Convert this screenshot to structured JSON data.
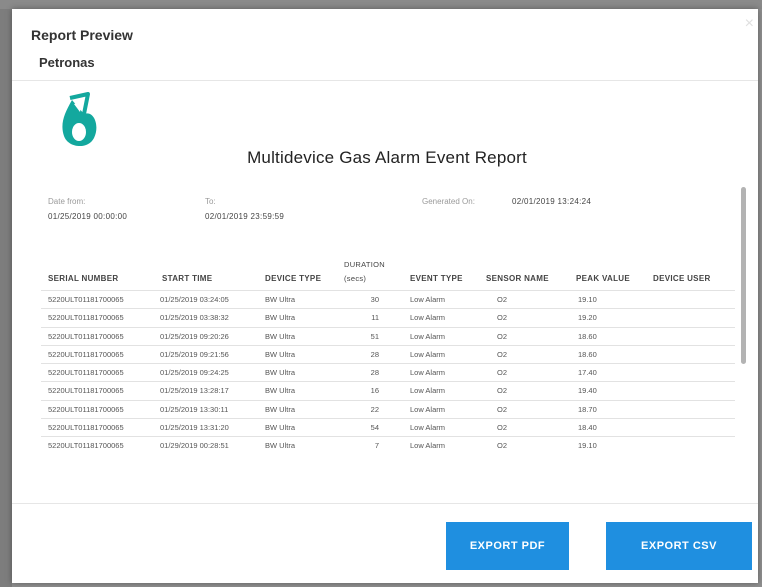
{
  "modal": {
    "title": "Report Preview",
    "subtitle": "Petronas",
    "close_label": "×"
  },
  "report": {
    "title": "Multidevice Gas Alarm Event Report",
    "date_from_label": "Date from:",
    "date_from_value": "01/25/2019 00:00:00",
    "to_label": "To:",
    "to_value": "02/01/2019 23:59:59",
    "generated_label": "Generated On:",
    "generated_value": "02/01/2019 13:24:24"
  },
  "table": {
    "headers": {
      "serial": "SERIAL NUMBER",
      "start": "START TIME",
      "device_type": "DEVICE TYPE",
      "duration": "DURATION",
      "duration_unit": "(secs)",
      "event_type": "EVENT TYPE",
      "sensor": "SENSOR NAME",
      "peak": "PEAK VALUE",
      "user": "DEVICE USER"
    },
    "rows": [
      [
        "5220ULT01181700065",
        "01/25/2019 03:24:05",
        "BW Ultra",
        "30",
        "Low Alarm",
        "O2",
        "19.10",
        ""
      ],
      [
        "5220ULT01181700065",
        "01/25/2019 03:38:32",
        "BW Ultra",
        "11",
        "Low Alarm",
        "O2",
        "19.20",
        ""
      ],
      [
        "5220ULT01181700065",
        "01/25/2019 09:20:26",
        "BW Ultra",
        "51",
        "Low Alarm",
        "O2",
        "18.60",
        ""
      ],
      [
        "5220ULT01181700065",
        "01/25/2019 09:21:56",
        "BW Ultra",
        "28",
        "Low Alarm",
        "O2",
        "18.60",
        ""
      ],
      [
        "5220ULT01181700065",
        "01/25/2019 09:24:25",
        "BW Ultra",
        "28",
        "Low Alarm",
        "O2",
        "17.40",
        ""
      ],
      [
        "5220ULT01181700065",
        "01/25/2019 13:28:17",
        "BW Ultra",
        "16",
        "Low Alarm",
        "O2",
        "19.40",
        ""
      ],
      [
        "5220ULT01181700065",
        "01/25/2019 13:30:11",
        "BW Ultra",
        "22",
        "Low Alarm",
        "O2",
        "18.70",
        ""
      ],
      [
        "5220ULT01181700065",
        "01/25/2019 13:31:20",
        "BW Ultra",
        "54",
        "Low Alarm",
        "O2",
        "18.40",
        ""
      ],
      [
        "5220ULT01181700065",
        "01/29/2019 00:28:51",
        "BW Ultra",
        "7",
        "Low Alarm",
        "O2",
        "19.10",
        ""
      ]
    ]
  },
  "buttons": {
    "export_pdf": "EXPORT PDF",
    "export_csv": "EXPORT CSV"
  },
  "colors": {
    "accent": "#1f8fe0",
    "logo_teal": "#13a89e"
  },
  "icons": {
    "logo": "petronas-logo-icon",
    "close": "close-icon"
  }
}
